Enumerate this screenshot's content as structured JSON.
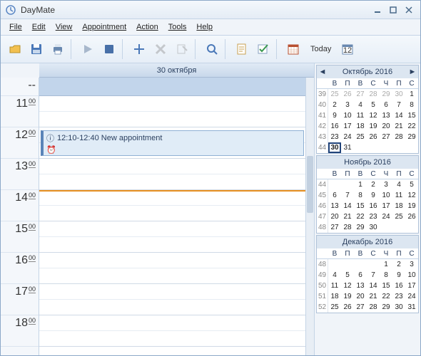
{
  "window": {
    "title": "DayMate"
  },
  "menu": {
    "file": "File",
    "edit": "Edit",
    "view": "View",
    "appointment": "Appointment",
    "action": "Action",
    "tools": "Tools",
    "help": "Help"
  },
  "toolbar": {
    "today": "Today"
  },
  "day": {
    "header": "30 октября"
  },
  "hours": [
    "--",
    "11",
    "12",
    "13",
    "14",
    "15",
    "16",
    "17",
    "18"
  ],
  "minutes": "00",
  "appointment": {
    "text": "12:10-12:40 New appointment"
  },
  "calendars": [
    {
      "title": "Октябрь 2016",
      "dow": [
        "В",
        "П",
        "В",
        "С",
        "Ч",
        "П",
        "С"
      ],
      "weeks": [
        {
          "wk": "39",
          "days": [
            {
              "n": "25",
              "o": true
            },
            {
              "n": "26",
              "o": true
            },
            {
              "n": "27",
              "o": true
            },
            {
              "n": "28",
              "o": true
            },
            {
              "n": "29",
              "o": true
            },
            {
              "n": "30",
              "o": true
            },
            {
              "n": "1"
            }
          ]
        },
        {
          "wk": "40",
          "days": [
            {
              "n": "2"
            },
            {
              "n": "3"
            },
            {
              "n": "4"
            },
            {
              "n": "5"
            },
            {
              "n": "6"
            },
            {
              "n": "7"
            },
            {
              "n": "8"
            }
          ]
        },
        {
          "wk": "41",
          "days": [
            {
              "n": "9"
            },
            {
              "n": "10"
            },
            {
              "n": "11"
            },
            {
              "n": "12"
            },
            {
              "n": "13"
            },
            {
              "n": "14"
            },
            {
              "n": "15"
            }
          ]
        },
        {
          "wk": "42",
          "days": [
            {
              "n": "16"
            },
            {
              "n": "17"
            },
            {
              "n": "18"
            },
            {
              "n": "19"
            },
            {
              "n": "20"
            },
            {
              "n": "21"
            },
            {
              "n": "22"
            }
          ]
        },
        {
          "wk": "43",
          "days": [
            {
              "n": "23"
            },
            {
              "n": "24"
            },
            {
              "n": "25"
            },
            {
              "n": "26"
            },
            {
              "n": "27"
            },
            {
              "n": "28"
            },
            {
              "n": "29"
            }
          ]
        },
        {
          "wk": "44",
          "days": [
            {
              "n": "30",
              "today": true
            },
            {
              "n": "31"
            },
            {
              "n": ""
            },
            {
              "n": ""
            },
            {
              "n": ""
            },
            {
              "n": ""
            },
            {
              "n": ""
            }
          ]
        }
      ],
      "nav": true
    },
    {
      "title": "Ноябрь 2016",
      "dow": [
        "В",
        "П",
        "В",
        "С",
        "Ч",
        "П",
        "С"
      ],
      "weeks": [
        {
          "wk": "44",
          "days": [
            {
              "n": ""
            },
            {
              "n": ""
            },
            {
              "n": "1"
            },
            {
              "n": "2"
            },
            {
              "n": "3"
            },
            {
              "n": "4"
            },
            {
              "n": "5"
            }
          ]
        },
        {
          "wk": "45",
          "days": [
            {
              "n": "6"
            },
            {
              "n": "7"
            },
            {
              "n": "8"
            },
            {
              "n": "9"
            },
            {
              "n": "10"
            },
            {
              "n": "11"
            },
            {
              "n": "12"
            }
          ]
        },
        {
          "wk": "46",
          "days": [
            {
              "n": "13"
            },
            {
              "n": "14"
            },
            {
              "n": "15"
            },
            {
              "n": "16"
            },
            {
              "n": "17"
            },
            {
              "n": "18"
            },
            {
              "n": "19"
            }
          ]
        },
        {
          "wk": "47",
          "days": [
            {
              "n": "20"
            },
            {
              "n": "21"
            },
            {
              "n": "22"
            },
            {
              "n": "23"
            },
            {
              "n": "24"
            },
            {
              "n": "25"
            },
            {
              "n": "26"
            }
          ]
        },
        {
          "wk": "48",
          "days": [
            {
              "n": "27"
            },
            {
              "n": "28"
            },
            {
              "n": "29"
            },
            {
              "n": "30"
            },
            {
              "n": ""
            },
            {
              "n": ""
            },
            {
              "n": ""
            }
          ]
        }
      ]
    },
    {
      "title": "Декабрь 2016",
      "dow": [
        "В",
        "П",
        "В",
        "С",
        "Ч",
        "П",
        "С"
      ],
      "weeks": [
        {
          "wk": "48",
          "days": [
            {
              "n": ""
            },
            {
              "n": ""
            },
            {
              "n": ""
            },
            {
              "n": ""
            },
            {
              "n": "1"
            },
            {
              "n": "2"
            },
            {
              "n": "3"
            }
          ]
        },
        {
          "wk": "49",
          "days": [
            {
              "n": "4"
            },
            {
              "n": "5"
            },
            {
              "n": "6"
            },
            {
              "n": "7"
            },
            {
              "n": "8"
            },
            {
              "n": "9"
            },
            {
              "n": "10"
            }
          ]
        },
        {
          "wk": "50",
          "days": [
            {
              "n": "11"
            },
            {
              "n": "12"
            },
            {
              "n": "13"
            },
            {
              "n": "14"
            },
            {
              "n": "15"
            },
            {
              "n": "16"
            },
            {
              "n": "17"
            }
          ]
        },
        {
          "wk": "51",
          "days": [
            {
              "n": "18"
            },
            {
              "n": "19"
            },
            {
              "n": "20"
            },
            {
              "n": "21"
            },
            {
              "n": "22"
            },
            {
              "n": "23"
            },
            {
              "n": "24"
            }
          ]
        },
        {
          "wk": "52",
          "days": [
            {
              "n": "25"
            },
            {
              "n": "26"
            },
            {
              "n": "27"
            },
            {
              "n": "28"
            },
            {
              "n": "29"
            },
            {
              "n": "30"
            },
            {
              "n": "31"
            }
          ]
        }
      ]
    }
  ]
}
